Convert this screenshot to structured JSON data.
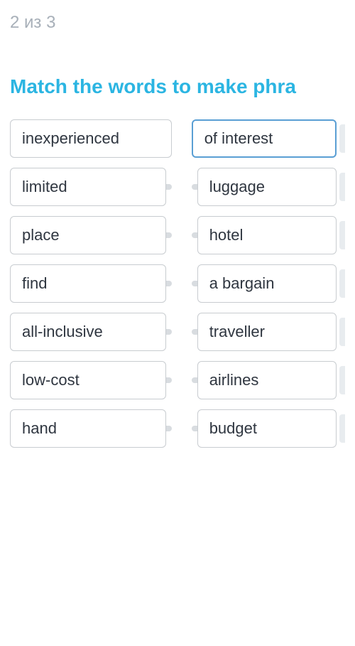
{
  "progress": "2 из 3",
  "title": "Match the words to make phra",
  "leftColumn": [
    "inexperienced",
    "limited",
    "place",
    "find",
    "all-inclusive",
    "low-cost",
    "hand"
  ],
  "rightColumn": [
    "of interest",
    "luggage",
    "hotel",
    "a bargain",
    "traveller",
    "airlines",
    "budget"
  ],
  "selectedRightIndex": 0
}
